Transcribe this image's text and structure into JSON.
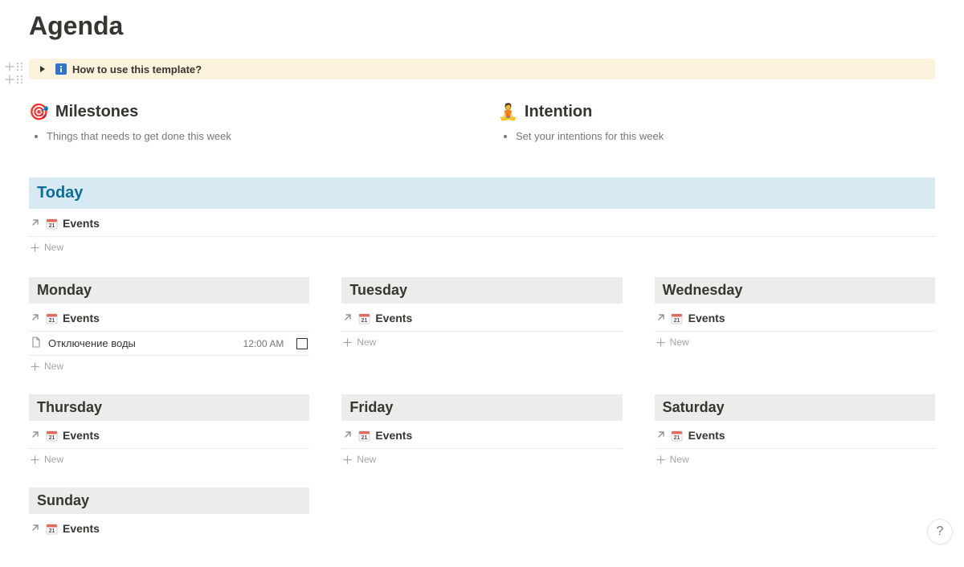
{
  "page": {
    "title": "Agenda"
  },
  "callout": {
    "text": "How to use this template?"
  },
  "milestones": {
    "heading": "Milestones",
    "bullets": [
      "Things that needs to get done this week"
    ]
  },
  "intention": {
    "heading": "Intention",
    "bullets": [
      "Set your intentions for this week"
    ]
  },
  "labels": {
    "events": "Events",
    "new": "New"
  },
  "today": {
    "heading": "Today"
  },
  "days": {
    "monday": {
      "heading": "Monday"
    },
    "tuesday": {
      "heading": "Tuesday"
    },
    "wednesday": {
      "heading": "Wednesday"
    },
    "thursday": {
      "heading": "Thursday"
    },
    "friday": {
      "heading": "Friday"
    },
    "saturday": {
      "heading": "Saturday"
    },
    "sunday": {
      "heading": "Sunday"
    }
  },
  "monday_events": [
    {
      "title": "Отключение воды",
      "time": "12:00 AM",
      "checked": false
    }
  ]
}
